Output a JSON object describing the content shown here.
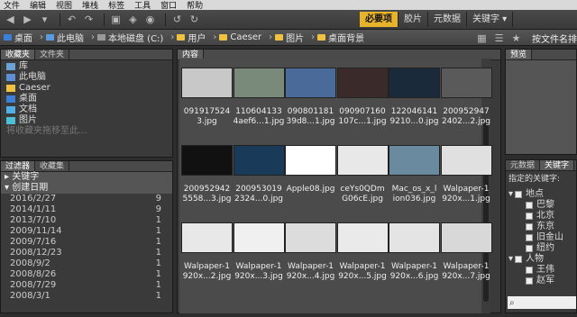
{
  "menu": [
    "文件",
    "编辑",
    "视图",
    "堆栈",
    "标签",
    "工具",
    "窗口",
    "帮助"
  ],
  "toolbar_icons": [
    "back-arrow-icon",
    "forward-arrow-icon",
    "boomerang-icon",
    "rotate-icon",
    "camera-icon",
    "refine-icon",
    "open-icon",
    "recent-icon",
    "rotate-left-icon",
    "rotate-right-icon"
  ],
  "workspaces": [
    "必要项",
    "胶片",
    "元数据",
    "关键字 ▾"
  ],
  "path": [
    "桌面",
    "此电脑",
    "本地磁盘 (C:)",
    "用户",
    "Caeser",
    "图片",
    "桌面背景"
  ],
  "path_right": "按文件名排",
  "fav_tabs": [
    "收藏夹",
    "文件夹"
  ],
  "favorites": [
    "库",
    "此电脑",
    "Caeser",
    "桌面",
    "文档",
    "图片"
  ],
  "fav_hint": "将收藏夹拖移至此...",
  "filter_tabs": [
    "过滤器",
    "收藏集"
  ],
  "filter": {
    "keyword": "关键字",
    "created": "创建日期",
    "dates": [
      [
        "2016/2/27",
        "9"
      ],
      [
        "2014/1/11",
        "9"
      ],
      [
        "2013/7/10",
        "1"
      ],
      [
        "2009/11/14",
        "1"
      ],
      [
        "2009/7/16",
        "1"
      ],
      [
        "2008/12/23",
        "1"
      ],
      [
        "2008/9/2",
        "1"
      ],
      [
        "2008/8/26",
        "1"
      ],
      [
        "2008/7/29",
        "1"
      ],
      [
        "2008/3/1",
        "1"
      ]
    ]
  },
  "content_tab": "内容",
  "thumbs": [
    [
      "091917524",
      "3.jpg",
      "#c8c8c8"
    ],
    [
      "110604133",
      "4aef6...1.jpg",
      "#7a8a7a"
    ],
    [
      "090801181",
      "39d8...1.jpg",
      "#4a6a9a"
    ],
    [
      "090907160",
      "107c...1.jpg",
      "#3a2a2a"
    ],
    [
      "122046141",
      "9210...0.jpg",
      "#1a2a3a"
    ],
    [
      "200952947",
      "2402...2.jpg",
      "#5a5a5a"
    ],
    [
      "200952942",
      "5558...3.jpg",
      "#111"
    ],
    [
      "200953019",
      "2324...0.jpg",
      "#1a3a5a"
    ],
    [
      "Apple08.jpg",
      "",
      "#ffffff"
    ],
    [
      "ceYs0QDm",
      "G06cE.jpg",
      "#e8e8e8"
    ],
    [
      "Mac_os_x_l",
      "ion036.jpg",
      "#6a8aa0"
    ],
    [
      "Walpaper-1",
      "920x...1.jpg",
      "#e0e0e0"
    ],
    [
      "Walpaper-1",
      "920x...2.jpg",
      "#e8e8e8"
    ],
    [
      "Walpaper-1",
      "920x...3.jpg",
      "#f0f0f0"
    ],
    [
      "Walpaper-1",
      "920x...4.jpg",
      "#dcdcdc"
    ],
    [
      "Walpaper-1",
      "920x...5.jpg",
      "#eaeaea"
    ],
    [
      "Walpaper-1",
      "920x...6.jpg",
      "#e4e4e4"
    ],
    [
      "Walpaper-1",
      "920x...7.jpg",
      "#d8d8d8"
    ]
  ],
  "preview_tab": "预览",
  "meta_tabs": [
    "元数据",
    "关键字"
  ],
  "kw_hint": "指定的关键字:",
  "keywords": [
    [
      "地点",
      true
    ],
    [
      "巴黎",
      false
    ],
    [
      "北京",
      false
    ],
    [
      "东京",
      false
    ],
    [
      "旧金山",
      false
    ],
    [
      "纽约",
      false
    ],
    [
      "人物",
      true
    ],
    [
      "王伟",
      false
    ],
    [
      "赵军",
      false
    ]
  ],
  "search_placeholder": ""
}
